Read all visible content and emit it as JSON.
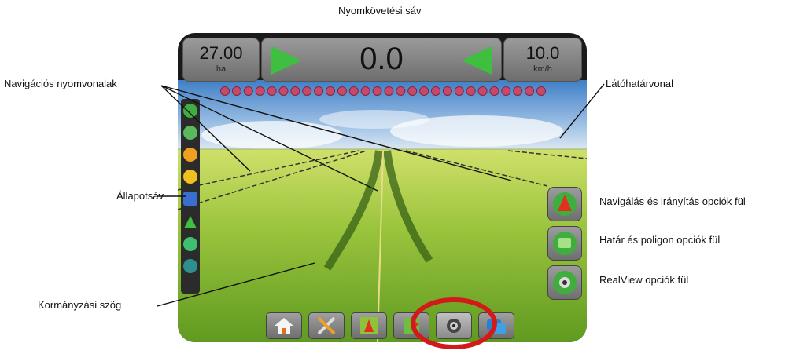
{
  "callouts": {
    "guideline_bar": "Nyomkövetési sáv",
    "nav_lines": "Navigációs nyomvonalak",
    "horizon": "Látóhatárvonal",
    "status_bar": "Állapotsáv",
    "nav_guidance_tab": "Navigálás és irányítás opciók fül",
    "boundary_tab": "Határ és poligon opciók fül",
    "realview_tab": "RealView opciók fül",
    "steering_angle": "Kormányzási szög"
  },
  "screen": {
    "area_value": "27.00",
    "area_unit": "ha",
    "cross_track": "0.0",
    "speed_value": "10.0",
    "speed_unit": "km/h",
    "led_count": 28,
    "colors": {
      "led": "#c9486a",
      "arrow": "#3fbf3f",
      "highlight_ring": "#d21a1a",
      "sky_top": "#3f7fc7",
      "field": "#8fc23a"
    },
    "status_icons": [
      "vehicle-icon",
      "gps-icon",
      "boom-icon",
      "radiation-icon",
      "magnet-icon",
      "arrow-up-icon",
      "drop-icon",
      "person-icon"
    ],
    "side_tabs": [
      "navigation-tab-icon",
      "boundary-tab-icon",
      "realview-tab-icon"
    ],
    "bottom_tabs": [
      "home-icon",
      "tools-icon",
      "field-map-icon",
      "polygon-icon",
      "camera-icon",
      "layers-icon"
    ]
  }
}
